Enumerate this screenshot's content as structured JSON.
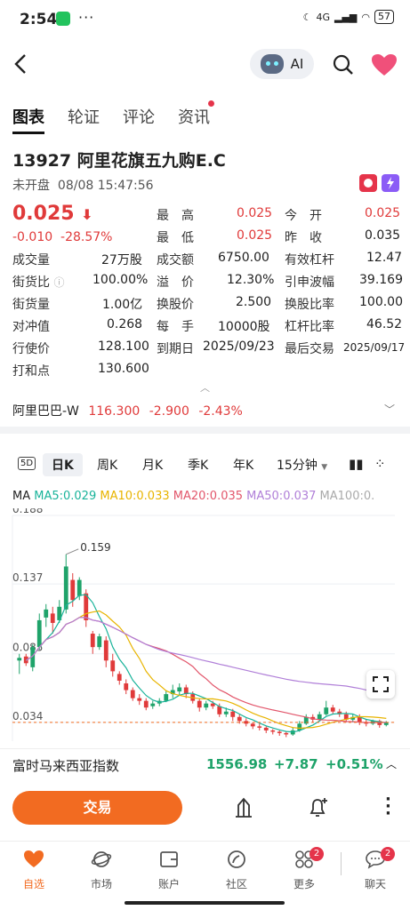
{
  "status": {
    "time": "2:54",
    "dots": "···",
    "net": "4G",
    "battery": "57"
  },
  "header": {
    "ai_label": "AI"
  },
  "tabs": [
    "图表",
    "轮证",
    "评论",
    "资讯"
  ],
  "stock": {
    "code_name": "13927  阿里花旗五九购E.C",
    "status": "未开盘",
    "datetime": "08/08 15:47:56",
    "price": "0.025",
    "change": "-0.010",
    "change_pct": "-28.57%"
  },
  "quote": {
    "high_l": "最　高",
    "high": "0.025",
    "today_open_l": "今　开",
    "today_open": "0.025",
    "low_l": "最　低",
    "low": "0.025",
    "prev_close_l": "昨　收",
    "prev_close": "0.035",
    "vol_l": "成交量",
    "vol": "27万股",
    "amount_l": "成交额",
    "amount": "6750.00",
    "eff_lev_l": "有效杠杆",
    "eff_lev": "12.47",
    "street_l": "街货比",
    "street": "100.00%",
    "premium_l": "溢　价",
    "premium": "12.30%",
    "iv_l": "引申波幅",
    "iv": "39.169",
    "outstanding_l": "街货量",
    "outstanding": "1.00亿",
    "conv_price_l": "换股价",
    "conv_price": "2.500",
    "conv_ratio_l": "换股比率",
    "conv_ratio": "100.00",
    "hedge_l": "对冲值",
    "hedge": "0.268",
    "lot_l": "每　手",
    "lot": "10000股",
    "lev_ratio_l": "杠杆比率",
    "lev_ratio": "46.52",
    "strike_l": "行使价",
    "strike": "128.100",
    "expiry_l": "到期日",
    "expiry": "2025/09/23",
    "last_trade_l": "最后交易",
    "last_trade": "2025/09/17",
    "hit_l": "打和点",
    "hit": "130.600"
  },
  "underlying": {
    "name": "阿里巴巴-W",
    "price": "116.300",
    "change": "-2.900",
    "pct": "-2.43%"
  },
  "ktabs": {
    "five_d": "5D",
    "day": "日K",
    "week": "周K",
    "month": "月K",
    "quarter": "季K",
    "year": "年K",
    "min": "15分钟"
  },
  "ma": {
    "label": "MA",
    "ma5": "MA5:0.029",
    "ma10": "MA10:0.033",
    "ma20": "MA20:0.035",
    "ma50": "MA50:0.037",
    "ma100": "MA100:0."
  },
  "chart_data": {
    "type": "candlestick",
    "y_ticks": [
      "0.188",
      "0.137",
      "0.085",
      "0.034"
    ],
    "high_label": "0.159",
    "ylim": [
      0.02,
      0.188
    ],
    "candles": [
      [
        0.08,
        0.082,
        0.07,
        0.085
      ],
      [
        0.083,
        0.078,
        0.076,
        0.085
      ],
      [
        0.075,
        0.09,
        0.072,
        0.092
      ],
      [
        0.09,
        0.11,
        0.088,
        0.115
      ],
      [
        0.112,
        0.118,
        0.105,
        0.122
      ],
      [
        0.115,
        0.108,
        0.1,
        0.12
      ],
      [
        0.11,
        0.12,
        0.108,
        0.125
      ],
      [
        0.118,
        0.15,
        0.115,
        0.159
      ],
      [
        0.14,
        0.125,
        0.12,
        0.145
      ],
      [
        0.128,
        0.14,
        0.125,
        0.142
      ],
      [
        0.13,
        0.11,
        0.105,
        0.133
      ],
      [
        0.1,
        0.09,
        0.085,
        0.102
      ],
      [
        0.09,
        0.098,
        0.088,
        0.1
      ],
      [
        0.095,
        0.08,
        0.075,
        0.098
      ],
      [
        0.08,
        0.072,
        0.068,
        0.085
      ],
      [
        0.07,
        0.065,
        0.062,
        0.072
      ],
      [
        0.063,
        0.058,
        0.055,
        0.066
      ],
      [
        0.058,
        0.052,
        0.05,
        0.06
      ],
      [
        0.052,
        0.05,
        0.047,
        0.055
      ],
      [
        0.05,
        0.045,
        0.043,
        0.052
      ],
      [
        0.046,
        0.048,
        0.044,
        0.05
      ],
      [
        0.048,
        0.05,
        0.046,
        0.052
      ],
      [
        0.05,
        0.055,
        0.049,
        0.058
      ],
      [
        0.055,
        0.058,
        0.052,
        0.062
      ],
      [
        0.057,
        0.06,
        0.054,
        0.063
      ],
      [
        0.06,
        0.055,
        0.052,
        0.062
      ],
      [
        0.055,
        0.05,
        0.048,
        0.057
      ],
      [
        0.05,
        0.045,
        0.042,
        0.052
      ],
      [
        0.045,
        0.048,
        0.043,
        0.05
      ],
      [
        0.048,
        0.046,
        0.044,
        0.05
      ],
      [
        0.046,
        0.04,
        0.038,
        0.048
      ],
      [
        0.04,
        0.042,
        0.038,
        0.045
      ],
      [
        0.042,
        0.038,
        0.035,
        0.044
      ],
      [
        0.038,
        0.035,
        0.033,
        0.04
      ],
      [
        0.035,
        0.033,
        0.031,
        0.037
      ],
      [
        0.033,
        0.031,
        0.029,
        0.034
      ],
      [
        0.031,
        0.03,
        0.028,
        0.033
      ],
      [
        0.03,
        0.028,
        0.026,
        0.031
      ],
      [
        0.028,
        0.027,
        0.025,
        0.029
      ],
      [
        0.027,
        0.026,
        0.024,
        0.028
      ],
      [
        0.026,
        0.025,
        0.023,
        0.027
      ],
      [
        0.025,
        0.028,
        0.024,
        0.03
      ],
      [
        0.028,
        0.033,
        0.027,
        0.035
      ],
      [
        0.033,
        0.038,
        0.032,
        0.04
      ],
      [
        0.038,
        0.036,
        0.034,
        0.04
      ],
      [
        0.036,
        0.04,
        0.035,
        0.042
      ],
      [
        0.04,
        0.045,
        0.039,
        0.05
      ],
      [
        0.045,
        0.042,
        0.04,
        0.047
      ],
      [
        0.042,
        0.04,
        0.038,
        0.044
      ],
      [
        0.04,
        0.036,
        0.034,
        0.042
      ],
      [
        0.036,
        0.038,
        0.034,
        0.04
      ],
      [
        0.038,
        0.034,
        0.032,
        0.04
      ],
      [
        0.034,
        0.033,
        0.031,
        0.036
      ],
      [
        0.033,
        0.035,
        0.032,
        0.036
      ],
      [
        0.035,
        0.032,
        0.03,
        0.036
      ],
      [
        0.032,
        0.034,
        0.031,
        0.035
      ]
    ]
  },
  "index": {
    "name": "富时马来西亚指数",
    "value": "1556.98",
    "change": "+7.87",
    "pct": "+0.51%"
  },
  "trade": {
    "label": "交易"
  },
  "nav": [
    {
      "label": "自选"
    },
    {
      "label": "市场"
    },
    {
      "label": "账户"
    },
    {
      "label": "社区"
    },
    {
      "label": "更多",
      "badge": "2"
    },
    {
      "label": "聊天",
      "badge": "2"
    }
  ],
  "colors": {
    "up": "#e03a3a",
    "down": "#1fa36a",
    "accent": "#f26b21"
  }
}
